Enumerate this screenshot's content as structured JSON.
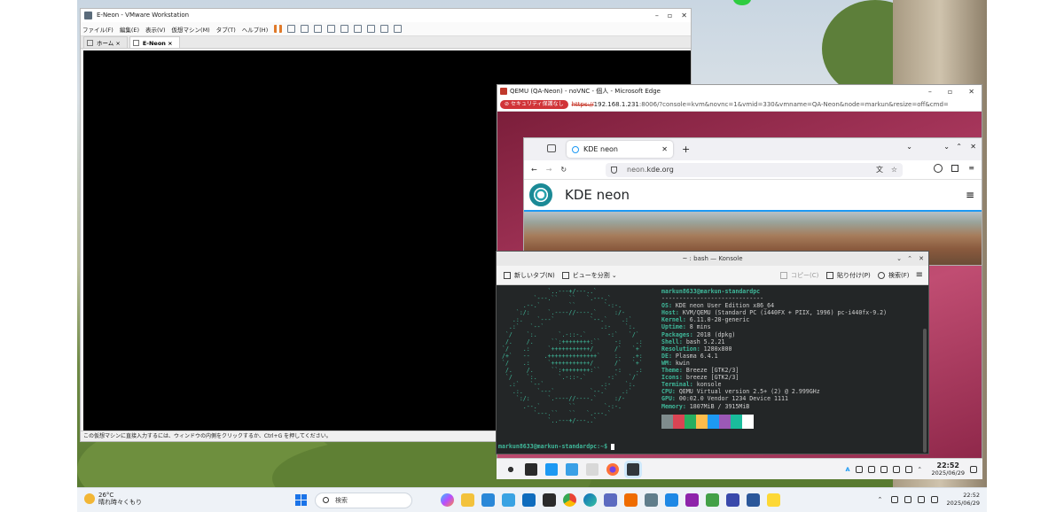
{
  "vmware": {
    "title": "E-Neon - VMware Workstation",
    "menu": [
      "ファイル(F)",
      "編集(E)",
      "表示(V)",
      "仮想マシン(M)",
      "タブ(T)",
      "ヘルプ(H)"
    ],
    "tabs": [
      {
        "label": "ホーム"
      },
      {
        "label": "E-Neon"
      }
    ],
    "status": "この仮想マシンに直接入力するには、ウィンドウの内側をクリックするか、Ctrl+G を押してください。"
  },
  "edge": {
    "title": "QEMU (QA-Neon) - noVNC - 個人 - Microsoft Edge",
    "security_badge": "セキュリティ保護なし",
    "url_scheme": "https://",
    "url_host": "192.168.1.231",
    "url_rest": ":8006/?console=kvm&novnc=1&vmid=330&vmname=QA-Neon&node=markun&resize=off&cmd="
  },
  "firefox": {
    "tab_label": "KDE neon",
    "url_dim": "neon.",
    "url_main": "kde.org",
    "page_title": "KDE neon"
  },
  "konsole": {
    "title": "~ : bash — Konsole",
    "new_tab": "新しいタブ(N)",
    "split_view": "ビューを分割",
    "copy": "コピー(C)",
    "paste": "貼り付け(P)",
    "search": "検索(F)",
    "user_host": "markun8633@markun-standardpc",
    "separator": "-----------------------------",
    "info": [
      {
        "k": "OS",
        "v": "KDE neon User Edition x86_64"
      },
      {
        "k": "Host",
        "v": "KVM/QEMU (Standard PC (i440FX + PIIX, 1996) pc-i440fx-9.2)"
      },
      {
        "k": "Kernel",
        "v": "6.11.0-28-generic"
      },
      {
        "k": "Uptime",
        "v": "8 mins"
      },
      {
        "k": "Packages",
        "v": "2018 (dpkg)"
      },
      {
        "k": "Shell",
        "v": "bash 5.2.21"
      },
      {
        "k": "Resolution",
        "v": "1280x800"
      },
      {
        "k": "DE",
        "v": "Plasma 6.4.1"
      },
      {
        "k": "WM",
        "v": "kwin"
      },
      {
        "k": "Theme",
        "v": "Breeze [GTK2/3]"
      },
      {
        "k": "Icons",
        "v": "breeze [GTK2/3]"
      },
      {
        "k": "Terminal",
        "v": "konsole"
      },
      {
        "k": "CPU",
        "v": "QEMU Virtual version 2.5+ (2) @ 2.999GHz"
      },
      {
        "k": "GPU",
        "v": "00:02.0 Vendor 1234 Device 1111"
      },
      {
        "k": "Memory",
        "v": "1807MiB / 3915MiB"
      }
    ],
    "palette": [
      "#7f8c8d",
      "#da4453",
      "#27ae60",
      "#fdbc4b",
      "#1d99f3",
      "#9b59b6",
      "#1abc9c",
      "#ffffff"
    ],
    "prompt": "markun8633@markun-standardpc:~$ "
  },
  "plasma": {
    "time": "22:52",
    "date": "2025/06/29",
    "tray_letter": "A"
  },
  "taskbar": {
    "temp": "26°C",
    "weather": "晴れ時々くもり",
    "search_placeholder": "検索",
    "time": "22:52",
    "date": "2025/06/29"
  }
}
